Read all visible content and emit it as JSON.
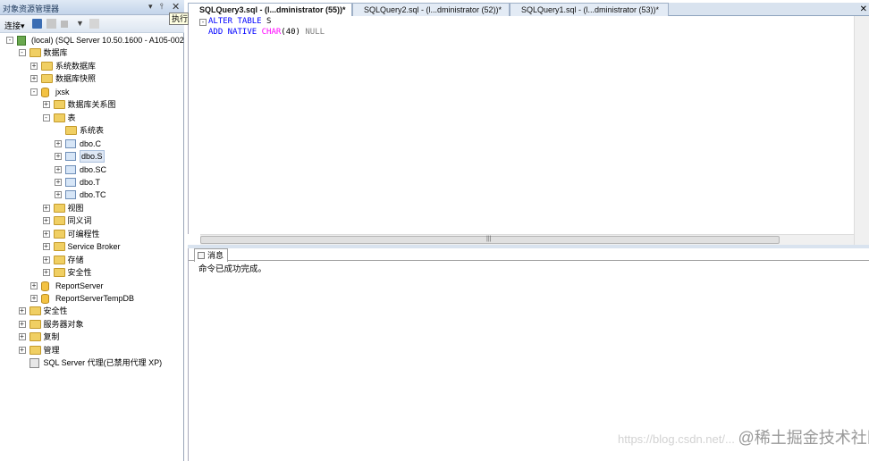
{
  "object_explorer": {
    "title": "对象资源管理器",
    "toolbar": {
      "connect_label": "连接",
      "dropdown": "▾"
    },
    "tooltip": "执行",
    "tree": [
      {
        "label": "(local) (SQL Server 10.50.1600 - A105-002",
        "icon": "server-icon",
        "expander": "⊟"
      },
      {
        "label": "数据库",
        "icon": "folder-icon",
        "expander": "⊟"
      },
      {
        "label": "系统数据库",
        "icon": "folder-icon",
        "expander": "⊞"
      },
      {
        "label": "数据库快照",
        "icon": "folder-icon",
        "expander": "⊞"
      },
      {
        "label": "jxsk",
        "icon": "database-icon",
        "expander": "⊟"
      },
      {
        "label": "数据库关系图",
        "icon": "folder-icon",
        "expander": "⊞"
      },
      {
        "label": "表",
        "icon": "folder-icon",
        "expander": "⊟"
      },
      {
        "label": "系统表",
        "icon": "folder-icon",
        "expander": ""
      },
      {
        "label": "dbo.C",
        "icon": "table-icon",
        "expander": "⊞"
      },
      {
        "label": "dbo.S",
        "icon": "table-icon",
        "expander": "⊞"
      },
      {
        "label": "dbo.SC",
        "icon": "table-icon",
        "expander": "⊞"
      },
      {
        "label": "dbo.T",
        "icon": "table-icon",
        "expander": "⊞"
      },
      {
        "label": "dbo.TC",
        "icon": "table-icon",
        "expander": "⊞"
      },
      {
        "label": "视图",
        "icon": "folder-icon",
        "expander": "⊞"
      },
      {
        "label": "同义词",
        "icon": "folder-icon",
        "expander": "⊞"
      },
      {
        "label": "可编程性",
        "icon": "folder-icon",
        "expander": "⊞"
      },
      {
        "label": "Service Broker",
        "icon": "folder-icon",
        "expander": "⊞"
      },
      {
        "label": "存储",
        "icon": "folder-icon",
        "expander": "⊞"
      },
      {
        "label": "安全性",
        "icon": "folder-icon",
        "expander": "⊞"
      },
      {
        "label": "ReportServer",
        "icon": "database-icon",
        "expander": "⊞"
      },
      {
        "label": "ReportServerTempDB",
        "icon": "database-icon",
        "expander": "⊞"
      },
      {
        "label": "安全性",
        "icon": "folder-icon",
        "expander": "⊞"
      },
      {
        "label": "服务器对象",
        "icon": "folder-icon",
        "expander": "⊞"
      },
      {
        "label": "复制",
        "icon": "folder-icon",
        "expander": "⊞"
      },
      {
        "label": "管理",
        "icon": "folder-icon",
        "expander": "⊞"
      },
      {
        "label": "SQL Server 代理(已禁用代理 XP)",
        "icon": "agent-icon",
        "expander": ""
      }
    ]
  },
  "tabs": [
    {
      "label": "SQLQuery3.sql - (l...dministrator (55))*",
      "active": true
    },
    {
      "label": "SQLQuery2.sql - (l...dministrator (52))*",
      "active": false
    },
    {
      "label": "SQLQuery1.sql - (l...dministrator (53))*",
      "active": false
    }
  ],
  "tabs_close": "✕",
  "editor": {
    "line1": {
      "kw": "ALTER TABLE",
      "ident": " S"
    },
    "line2": {
      "kw": "ADD NATIVE",
      "fn": " CHAR",
      "args": "(40) ",
      "nul": "NULL"
    }
  },
  "results": {
    "tab_label": "消息",
    "message": "命令已成功完成。"
  },
  "watermark": {
    "url": "https://blog.csdn.net/...",
    "brand": "@稀土掘金技术社区"
  }
}
